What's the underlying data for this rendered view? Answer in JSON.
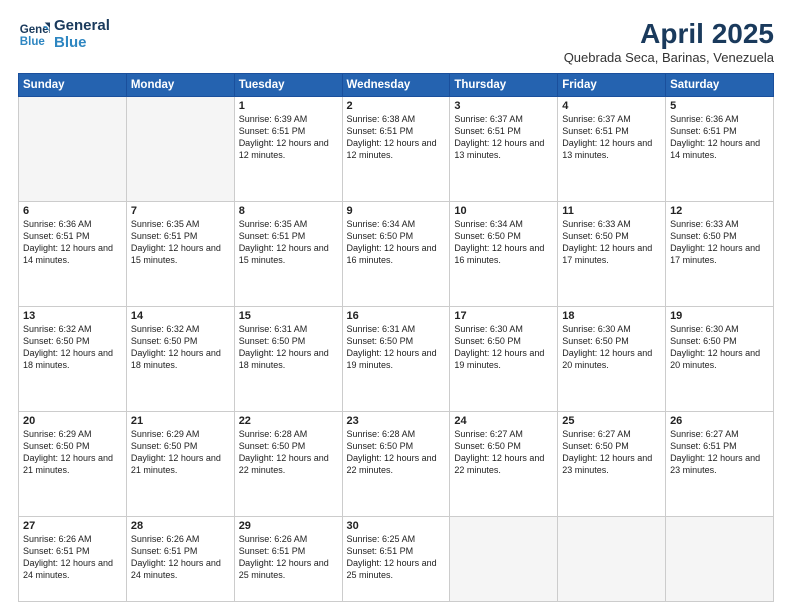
{
  "header": {
    "logo_line1": "General",
    "logo_line2": "Blue",
    "month_year": "April 2025",
    "location": "Quebrada Seca, Barinas, Venezuela"
  },
  "days_of_week": [
    "Sunday",
    "Monday",
    "Tuesday",
    "Wednesday",
    "Thursday",
    "Friday",
    "Saturday"
  ],
  "weeks": [
    [
      {
        "day": "",
        "empty": true
      },
      {
        "day": "",
        "empty": true
      },
      {
        "day": "1",
        "sunrise": "6:39 AM",
        "sunset": "6:51 PM",
        "daylight": "12 hours and 12 minutes."
      },
      {
        "day": "2",
        "sunrise": "6:38 AM",
        "sunset": "6:51 PM",
        "daylight": "12 hours and 12 minutes."
      },
      {
        "day": "3",
        "sunrise": "6:37 AM",
        "sunset": "6:51 PM",
        "daylight": "12 hours and 13 minutes."
      },
      {
        "day": "4",
        "sunrise": "6:37 AM",
        "sunset": "6:51 PM",
        "daylight": "12 hours and 13 minutes."
      },
      {
        "day": "5",
        "sunrise": "6:36 AM",
        "sunset": "6:51 PM",
        "daylight": "12 hours and 14 minutes."
      }
    ],
    [
      {
        "day": "6",
        "sunrise": "6:36 AM",
        "sunset": "6:51 PM",
        "daylight": "12 hours and 14 minutes."
      },
      {
        "day": "7",
        "sunrise": "6:35 AM",
        "sunset": "6:51 PM",
        "daylight": "12 hours and 15 minutes."
      },
      {
        "day": "8",
        "sunrise": "6:35 AM",
        "sunset": "6:51 PM",
        "daylight": "12 hours and 15 minutes."
      },
      {
        "day": "9",
        "sunrise": "6:34 AM",
        "sunset": "6:50 PM",
        "daylight": "12 hours and 16 minutes."
      },
      {
        "day": "10",
        "sunrise": "6:34 AM",
        "sunset": "6:50 PM",
        "daylight": "12 hours and 16 minutes."
      },
      {
        "day": "11",
        "sunrise": "6:33 AM",
        "sunset": "6:50 PM",
        "daylight": "12 hours and 17 minutes."
      },
      {
        "day": "12",
        "sunrise": "6:33 AM",
        "sunset": "6:50 PM",
        "daylight": "12 hours and 17 minutes."
      }
    ],
    [
      {
        "day": "13",
        "sunrise": "6:32 AM",
        "sunset": "6:50 PM",
        "daylight": "12 hours and 18 minutes."
      },
      {
        "day": "14",
        "sunrise": "6:32 AM",
        "sunset": "6:50 PM",
        "daylight": "12 hours and 18 minutes."
      },
      {
        "day": "15",
        "sunrise": "6:31 AM",
        "sunset": "6:50 PM",
        "daylight": "12 hours and 18 minutes."
      },
      {
        "day": "16",
        "sunrise": "6:31 AM",
        "sunset": "6:50 PM",
        "daylight": "12 hours and 19 minutes."
      },
      {
        "day": "17",
        "sunrise": "6:30 AM",
        "sunset": "6:50 PM",
        "daylight": "12 hours and 19 minutes."
      },
      {
        "day": "18",
        "sunrise": "6:30 AM",
        "sunset": "6:50 PM",
        "daylight": "12 hours and 20 minutes."
      },
      {
        "day": "19",
        "sunrise": "6:30 AM",
        "sunset": "6:50 PM",
        "daylight": "12 hours and 20 minutes."
      }
    ],
    [
      {
        "day": "20",
        "sunrise": "6:29 AM",
        "sunset": "6:50 PM",
        "daylight": "12 hours and 21 minutes."
      },
      {
        "day": "21",
        "sunrise": "6:29 AM",
        "sunset": "6:50 PM",
        "daylight": "12 hours and 21 minutes."
      },
      {
        "day": "22",
        "sunrise": "6:28 AM",
        "sunset": "6:50 PM",
        "daylight": "12 hours and 22 minutes."
      },
      {
        "day": "23",
        "sunrise": "6:28 AM",
        "sunset": "6:50 PM",
        "daylight": "12 hours and 22 minutes."
      },
      {
        "day": "24",
        "sunrise": "6:27 AM",
        "sunset": "6:50 PM",
        "daylight": "12 hours and 22 minutes."
      },
      {
        "day": "25",
        "sunrise": "6:27 AM",
        "sunset": "6:50 PM",
        "daylight": "12 hours and 23 minutes."
      },
      {
        "day": "26",
        "sunrise": "6:27 AM",
        "sunset": "6:51 PM",
        "daylight": "12 hours and 23 minutes."
      }
    ],
    [
      {
        "day": "27",
        "sunrise": "6:26 AM",
        "sunset": "6:51 PM",
        "daylight": "12 hours and 24 minutes."
      },
      {
        "day": "28",
        "sunrise": "6:26 AM",
        "sunset": "6:51 PM",
        "daylight": "12 hours and 24 minutes."
      },
      {
        "day": "29",
        "sunrise": "6:26 AM",
        "sunset": "6:51 PM",
        "daylight": "12 hours and 25 minutes."
      },
      {
        "day": "30",
        "sunrise": "6:25 AM",
        "sunset": "6:51 PM",
        "daylight": "12 hours and 25 minutes."
      },
      {
        "day": "",
        "empty": true
      },
      {
        "day": "",
        "empty": true
      },
      {
        "day": "",
        "empty": true
      }
    ]
  ],
  "labels": {
    "sunrise_prefix": "Sunrise: ",
    "sunset_prefix": "Sunset: ",
    "daylight_prefix": "Daylight: "
  }
}
